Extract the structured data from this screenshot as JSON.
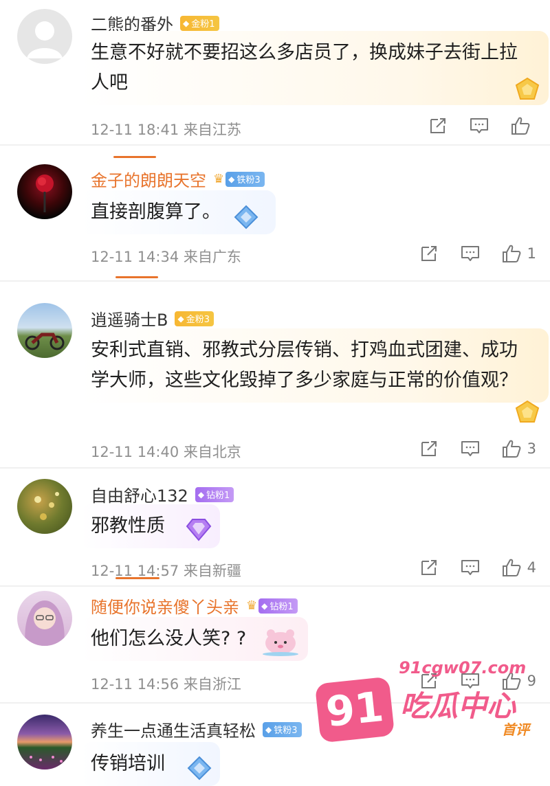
{
  "comments": [
    {
      "username": "二熊的番外",
      "badge": "金粉1",
      "text": "生意不好就不要招这么多店员了，换成妹子去街上拉人吧",
      "time": "12-11 18:41",
      "location": "来自江苏",
      "likes": ""
    },
    {
      "username": "金子的朗朗天空",
      "badge": "铁粉3",
      "text": "直接剖腹算了。",
      "time": "12-11 14:34",
      "location": "来自广东",
      "likes": "1"
    },
    {
      "username": "逍遥骑士B",
      "badge": "金粉3",
      "text": "安利式直销、邪教式分层传销、打鸡血式团建、成功学大师，这些文化毁掉了多少家庭与正常的价值观？",
      "time": "12-11 14:40",
      "location": "来自北京",
      "likes": "3"
    },
    {
      "username": "自由舒心132",
      "badge": "钻粉1",
      "text": "邪教性质",
      "time": "12-11 14:57",
      "location": "来自新疆",
      "likes": "4"
    },
    {
      "username": "随便你说亲傻丫头亲",
      "badge": "钻粉1",
      "text": "他们怎么没人笑? ?",
      "time": "12-11 14:56",
      "location": "来自浙江",
      "likes": "9"
    },
    {
      "username": "养生一点通生活真轻松",
      "badge": "铁粉3",
      "text": "传销培训",
      "pin_tag": "首评"
    }
  ],
  "watermark": {
    "number": "91",
    "url": "91cgw07.com",
    "text": "吃瓜中心"
  },
  "colors": {
    "accent": "#e8742c",
    "gold_badge": "#f7b733",
    "iron_badge": "#5aa0e8",
    "diamond_badge": "#a46df0",
    "watermark": "#f15b8b"
  }
}
